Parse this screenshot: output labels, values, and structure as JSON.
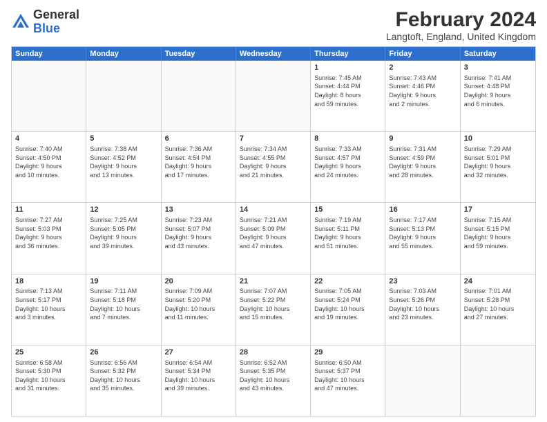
{
  "header": {
    "logo_general": "General",
    "logo_blue": "Blue",
    "month_title": "February 2024",
    "location": "Langtoft, England, United Kingdom"
  },
  "days_of_week": [
    "Sunday",
    "Monday",
    "Tuesday",
    "Wednesday",
    "Thursday",
    "Friday",
    "Saturday"
  ],
  "weeks": [
    [
      {
        "day": "",
        "info": "",
        "empty": true
      },
      {
        "day": "",
        "info": "",
        "empty": true
      },
      {
        "day": "",
        "info": "",
        "empty": true
      },
      {
        "day": "",
        "info": "",
        "empty": true
      },
      {
        "day": "1",
        "info": "Sunrise: 7:45 AM\nSunset: 4:44 PM\nDaylight: 8 hours\nand 59 minutes."
      },
      {
        "day": "2",
        "info": "Sunrise: 7:43 AM\nSunset: 4:46 PM\nDaylight: 9 hours\nand 2 minutes."
      },
      {
        "day": "3",
        "info": "Sunrise: 7:41 AM\nSunset: 4:48 PM\nDaylight: 9 hours\nand 6 minutes."
      }
    ],
    [
      {
        "day": "4",
        "info": "Sunrise: 7:40 AM\nSunset: 4:50 PM\nDaylight: 9 hours\nand 10 minutes."
      },
      {
        "day": "5",
        "info": "Sunrise: 7:38 AM\nSunset: 4:52 PM\nDaylight: 9 hours\nand 13 minutes."
      },
      {
        "day": "6",
        "info": "Sunrise: 7:36 AM\nSunset: 4:54 PM\nDaylight: 9 hours\nand 17 minutes."
      },
      {
        "day": "7",
        "info": "Sunrise: 7:34 AM\nSunset: 4:55 PM\nDaylight: 9 hours\nand 21 minutes."
      },
      {
        "day": "8",
        "info": "Sunrise: 7:33 AM\nSunset: 4:57 PM\nDaylight: 9 hours\nand 24 minutes."
      },
      {
        "day": "9",
        "info": "Sunrise: 7:31 AM\nSunset: 4:59 PM\nDaylight: 9 hours\nand 28 minutes."
      },
      {
        "day": "10",
        "info": "Sunrise: 7:29 AM\nSunset: 5:01 PM\nDaylight: 9 hours\nand 32 minutes."
      }
    ],
    [
      {
        "day": "11",
        "info": "Sunrise: 7:27 AM\nSunset: 5:03 PM\nDaylight: 9 hours\nand 36 minutes."
      },
      {
        "day": "12",
        "info": "Sunrise: 7:25 AM\nSunset: 5:05 PM\nDaylight: 9 hours\nand 39 minutes."
      },
      {
        "day": "13",
        "info": "Sunrise: 7:23 AM\nSunset: 5:07 PM\nDaylight: 9 hours\nand 43 minutes."
      },
      {
        "day": "14",
        "info": "Sunrise: 7:21 AM\nSunset: 5:09 PM\nDaylight: 9 hours\nand 47 minutes."
      },
      {
        "day": "15",
        "info": "Sunrise: 7:19 AM\nSunset: 5:11 PM\nDaylight: 9 hours\nand 51 minutes."
      },
      {
        "day": "16",
        "info": "Sunrise: 7:17 AM\nSunset: 5:13 PM\nDaylight: 9 hours\nand 55 minutes."
      },
      {
        "day": "17",
        "info": "Sunrise: 7:15 AM\nSunset: 5:15 PM\nDaylight: 9 hours\nand 59 minutes."
      }
    ],
    [
      {
        "day": "18",
        "info": "Sunrise: 7:13 AM\nSunset: 5:17 PM\nDaylight: 10 hours\nand 3 minutes."
      },
      {
        "day": "19",
        "info": "Sunrise: 7:11 AM\nSunset: 5:18 PM\nDaylight: 10 hours\nand 7 minutes."
      },
      {
        "day": "20",
        "info": "Sunrise: 7:09 AM\nSunset: 5:20 PM\nDaylight: 10 hours\nand 11 minutes."
      },
      {
        "day": "21",
        "info": "Sunrise: 7:07 AM\nSunset: 5:22 PM\nDaylight: 10 hours\nand 15 minutes."
      },
      {
        "day": "22",
        "info": "Sunrise: 7:05 AM\nSunset: 5:24 PM\nDaylight: 10 hours\nand 19 minutes."
      },
      {
        "day": "23",
        "info": "Sunrise: 7:03 AM\nSunset: 5:26 PM\nDaylight: 10 hours\nand 23 minutes."
      },
      {
        "day": "24",
        "info": "Sunrise: 7:01 AM\nSunset: 5:28 PM\nDaylight: 10 hours\nand 27 minutes."
      }
    ],
    [
      {
        "day": "25",
        "info": "Sunrise: 6:58 AM\nSunset: 5:30 PM\nDaylight: 10 hours\nand 31 minutes."
      },
      {
        "day": "26",
        "info": "Sunrise: 6:56 AM\nSunset: 5:32 PM\nDaylight: 10 hours\nand 35 minutes."
      },
      {
        "day": "27",
        "info": "Sunrise: 6:54 AM\nSunset: 5:34 PM\nDaylight: 10 hours\nand 39 minutes."
      },
      {
        "day": "28",
        "info": "Sunrise: 6:52 AM\nSunset: 5:35 PM\nDaylight: 10 hours\nand 43 minutes."
      },
      {
        "day": "29",
        "info": "Sunrise: 6:50 AM\nSunset: 5:37 PM\nDaylight: 10 hours\nand 47 minutes."
      },
      {
        "day": "",
        "info": "",
        "empty": true
      },
      {
        "day": "",
        "info": "",
        "empty": true
      }
    ]
  ]
}
